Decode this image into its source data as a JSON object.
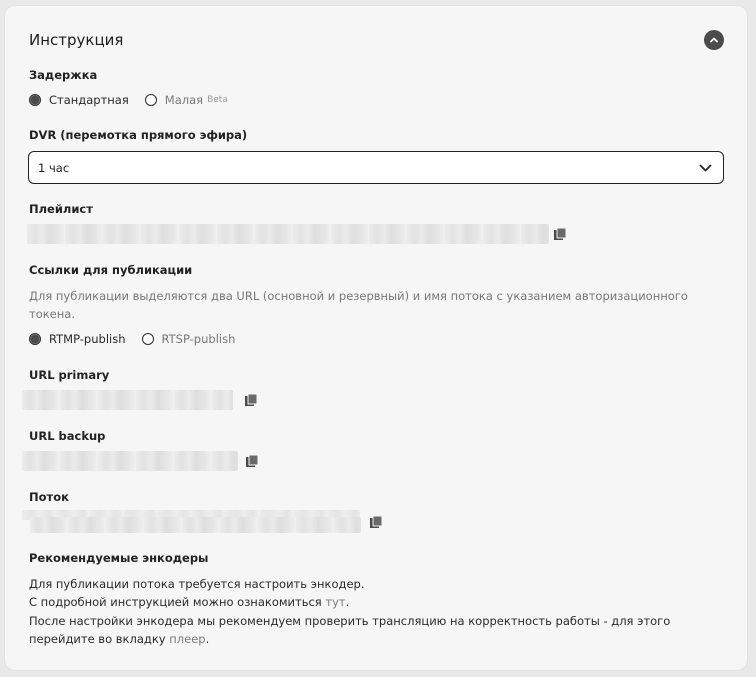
{
  "card": {
    "title": "Инструкция",
    "collapse_icon": "chevron-up-icon"
  },
  "latency": {
    "label": "Задержка",
    "options": [
      {
        "label": "Стандартная",
        "selected": true
      },
      {
        "label": "Малая",
        "badge": "Beta",
        "selected": false
      }
    ]
  },
  "dvr": {
    "label": "DVR (перемотка прямого эфира)",
    "value": "1 час"
  },
  "playlist": {
    "label": "Плейлист",
    "value_redacted": true,
    "copy_icon": "copy-icon"
  },
  "publish": {
    "label": "Ссылки для публикации",
    "description": "Для публикации выделяются два URL (основной и резервный) и имя потока с указанием авторизационного токена.",
    "options": [
      {
        "label": "RTMP-publish",
        "selected": true
      },
      {
        "label": "RTSP-publish",
        "selected": false
      }
    ]
  },
  "url_primary": {
    "label": "URL primary",
    "value_redacted": true
  },
  "url_backup": {
    "label": "URL backup",
    "value_redacted": true
  },
  "stream": {
    "label": "Поток",
    "value_redacted": true
  },
  "encoders": {
    "label": "Рекомендуемые энкодеры",
    "line1": "Для публикации потока требуется настроить энкодер.",
    "line2_prefix": "С подробной инструкцией можно ознакомиться ",
    "line2_link": "тут",
    "line2_suffix": ".",
    "line3": "После настройки энкодера мы рекомендуем проверить трансляцию на корректность работы - для этого",
    "line4_prefix": "перейдите во вкладку ",
    "line4_link": "плеер",
    "line4_suffix": "."
  }
}
